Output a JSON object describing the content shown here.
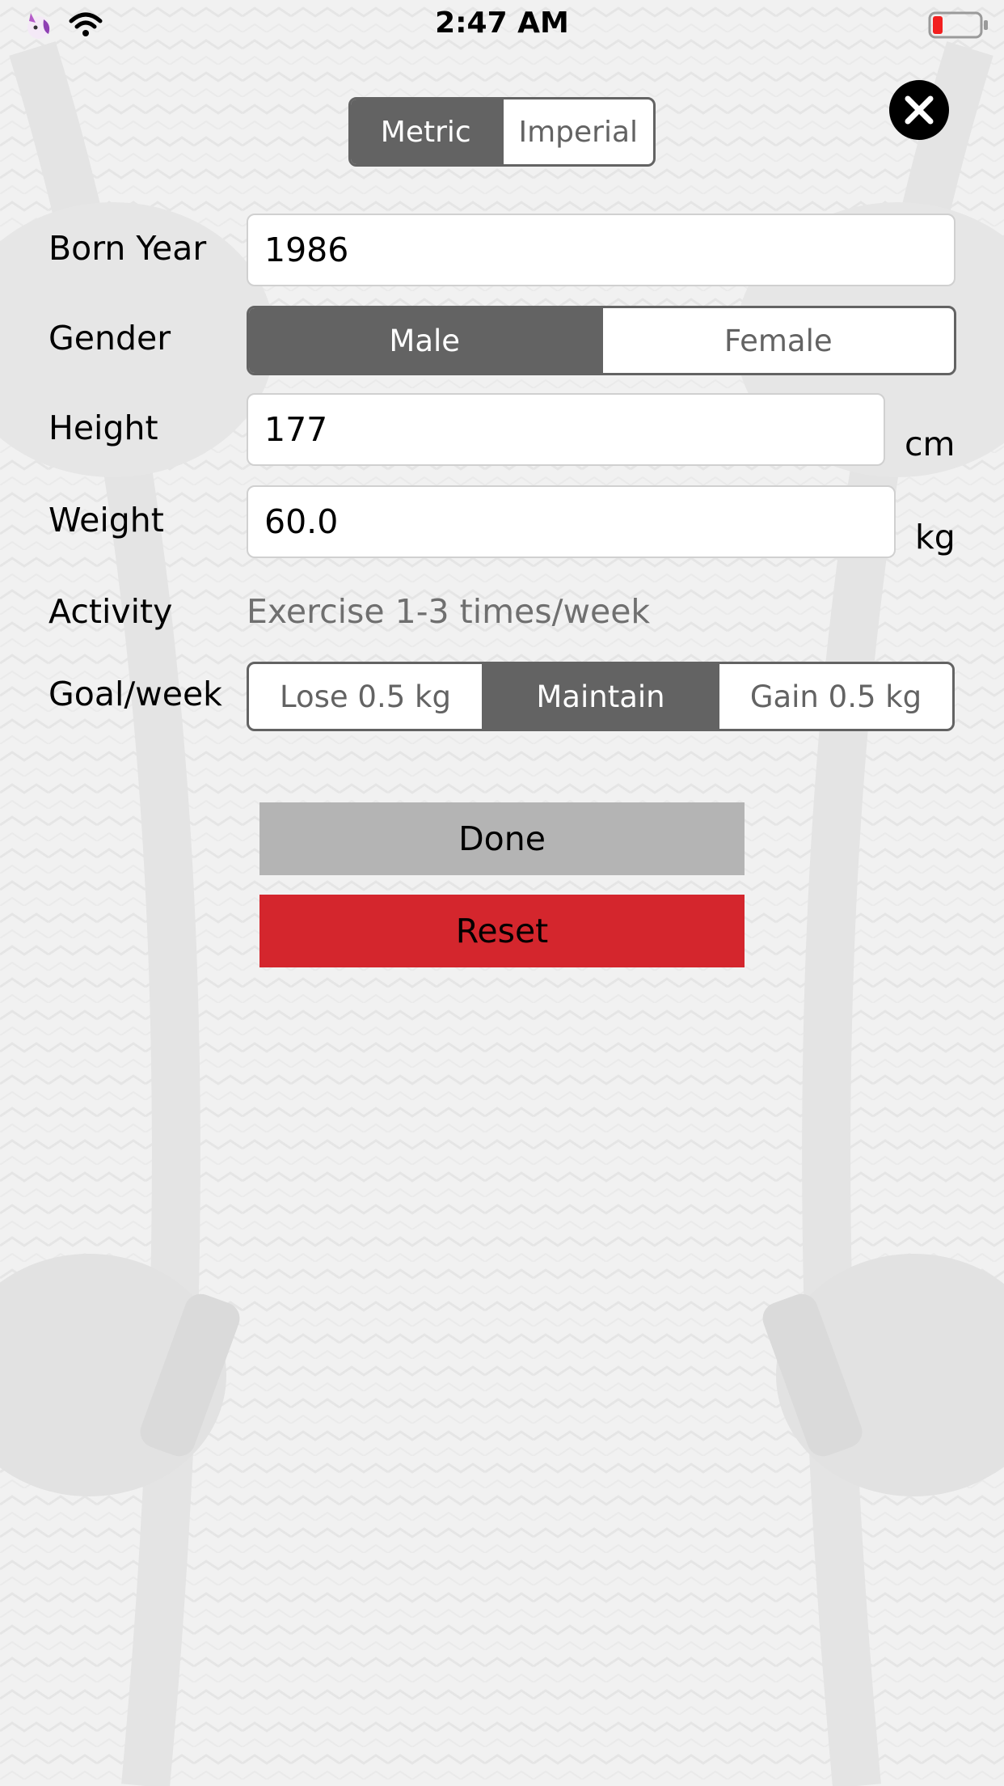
{
  "status_bar": {
    "time": "2:47 AM",
    "left_icons": [
      "unicorn-icon",
      "wifi-icon"
    ],
    "battery": "battery-low-icon"
  },
  "units": {
    "options": [
      "Metric",
      "Imperial"
    ],
    "selected": "Metric"
  },
  "close": {
    "icon": "close-icon"
  },
  "form": {
    "born_year": {
      "label": "Born Year",
      "value": "1986"
    },
    "gender": {
      "label": "Gender",
      "options": [
        "Male",
        "Female"
      ],
      "selected": "Male"
    },
    "height": {
      "label": "Height",
      "value": "177",
      "unit": "cm"
    },
    "weight": {
      "label": "Weight",
      "value": "60.0",
      "unit": "kg"
    },
    "activity": {
      "label": "Activity",
      "value": "Exercise 1-3 times/week"
    },
    "goal": {
      "label": "Goal/week",
      "options": [
        "Lose 0.5 kg",
        "Maintain",
        "Gain 0.5 kg"
      ],
      "selected": "Maintain"
    }
  },
  "actions": {
    "done": "Done",
    "reset": "Reset"
  },
  "colors": {
    "segment_selected": "#636363",
    "reset": "#d4262d",
    "done": "#b4b4b4"
  }
}
